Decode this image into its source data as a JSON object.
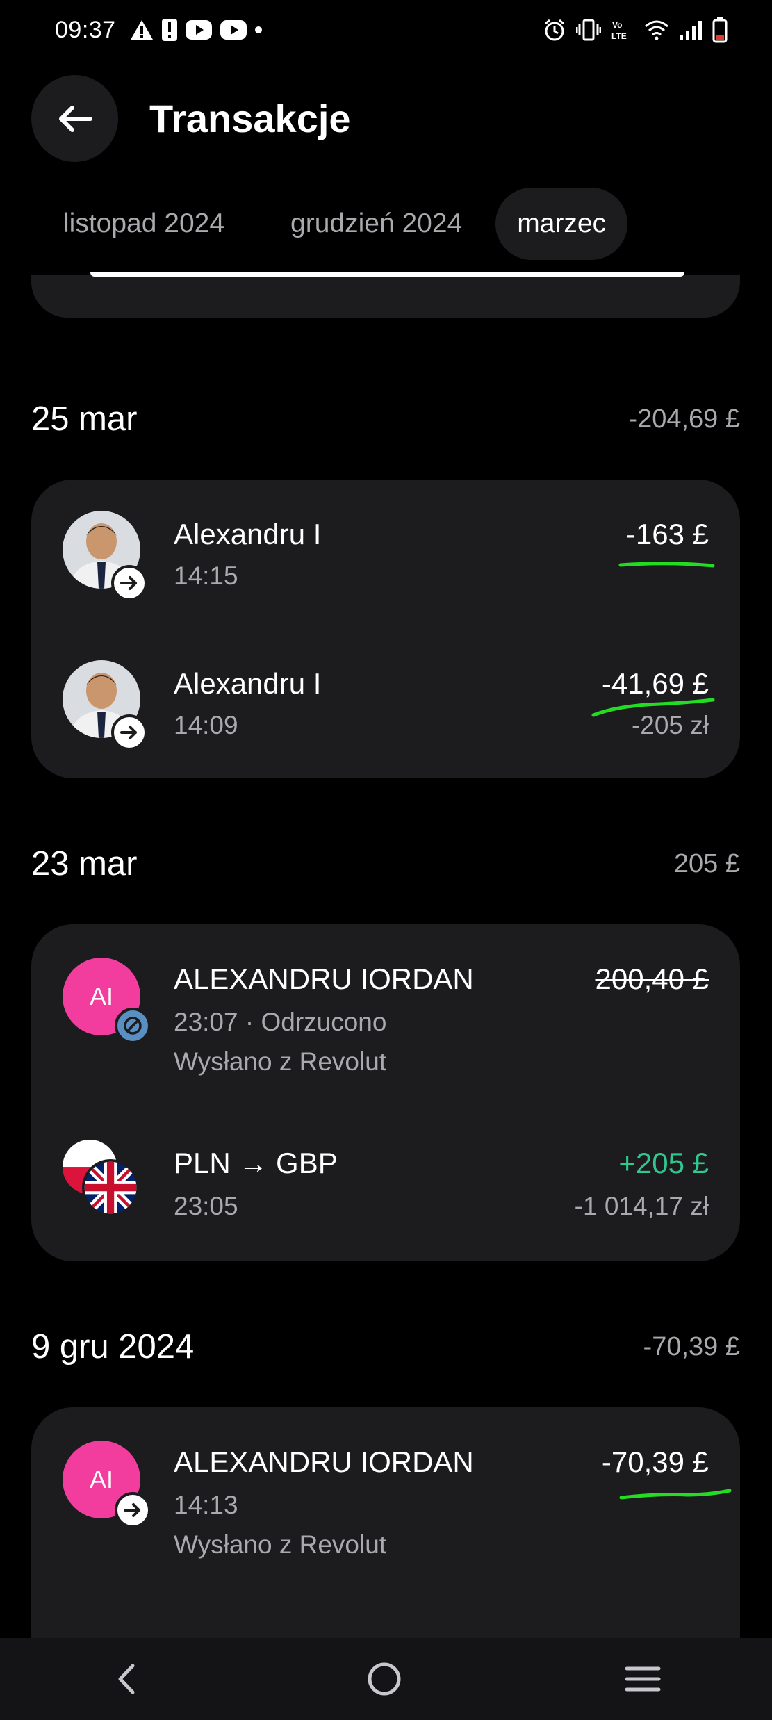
{
  "status_bar": {
    "time": "09:37",
    "left_icons": [
      "warning-icon",
      "alert-icon",
      "youtube-icon",
      "youtube-icon",
      "dot-icon"
    ],
    "right_icons": [
      "alarm-icon",
      "vibrate-icon",
      "volte-icon",
      "wifi-icon",
      "signal-icon",
      "battery-icon"
    ]
  },
  "header": {
    "title": "Transakcje",
    "back_icon": "arrow-left-icon"
  },
  "tabs": [
    {
      "label": "listopad 2024",
      "active": false
    },
    {
      "label": "grudzień 2024",
      "active": false
    },
    {
      "label": "marzec",
      "active": true
    }
  ],
  "groups": [
    {
      "date": "25 mar",
      "total": "-204,69 £",
      "transactions": [
        {
          "name": "Alexandru I",
          "time": "14:15",
          "amount": "-163 £",
          "avatar": "photo",
          "badge": "arrow-right-icon"
        },
        {
          "name": "Alexandru I",
          "time": "14:09",
          "amount": "-41,69 £",
          "amount_secondary": "-205 zł",
          "avatar": "photo",
          "badge": "arrow-right-icon"
        }
      ]
    },
    {
      "date": "23 mar",
      "total": "205 £",
      "transactions": [
        {
          "name": "ALEXANDRU IORDAN",
          "time": "23:07 · Odrzucono",
          "note": "Wysłano z Revolut",
          "amount": "200,40 £",
          "avatar_initials": "AI",
          "badge": "blocked-icon",
          "struck": true
        },
        {
          "name": "PLN → GBP",
          "time": "23:05",
          "amount": "+205 £",
          "amount_secondary": "-1 014,17 zł",
          "avatar": "flags",
          "positive": true
        }
      ]
    },
    {
      "date": "9 gru 2024",
      "total": "-70,39 £",
      "transactions": [
        {
          "name": "ALEXANDRU IORDAN",
          "time": "14:13",
          "note": "Wysłano z Revolut",
          "amount": "-70,39 £",
          "avatar_initials": "AI",
          "badge": "arrow-right-icon"
        }
      ]
    }
  ],
  "nav_bar": {
    "icons": [
      "back-nav-icon",
      "home-nav-icon",
      "recents-nav-icon"
    ]
  },
  "colors": {
    "background": "#000000",
    "card": "#1c1c1e",
    "secondary_text": "#a9a9ae",
    "positive": "#2fc990",
    "avatar_pink": "#f23d9f",
    "highlight_marker": "#22dd22"
  }
}
